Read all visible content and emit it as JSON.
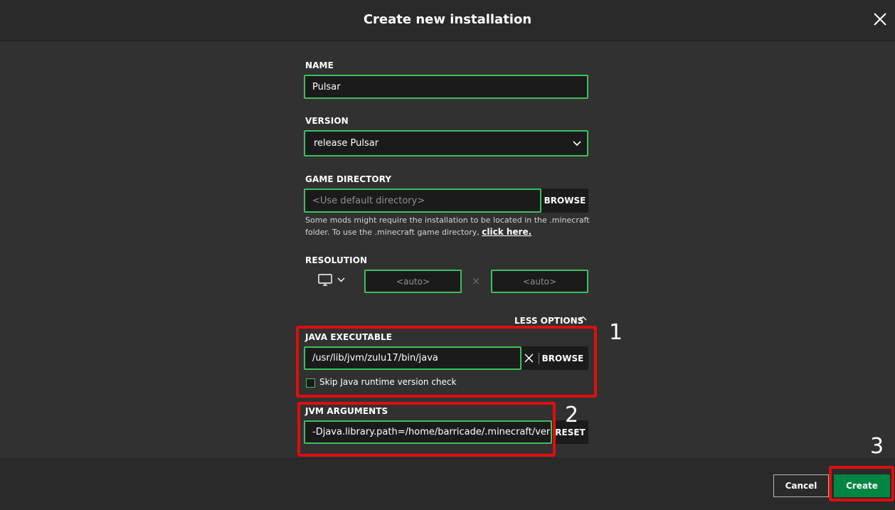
{
  "dialog": {
    "title": "Create new installation"
  },
  "icons": {
    "close": "close-icon",
    "dropdown": "chevron-down-icon",
    "monitor": "monitor-icon",
    "clear": "close-icon",
    "less": "chevron-up-icon"
  },
  "name": {
    "label": "NAME",
    "value": "Pulsar"
  },
  "version": {
    "label": "VERSION",
    "value": "release Pulsar"
  },
  "game_directory": {
    "label": "GAME DIRECTORY",
    "placeholder": "<Use default directory>",
    "browse_label": "BROWSE",
    "note": "Some mods might require the installation to be located in the .minecraft folder. To use the .minecraft game directory,",
    "note_link": "click here."
  },
  "resolution": {
    "label": "RESOLUTION",
    "width_placeholder": "<auto>",
    "height_placeholder": "<auto>",
    "separator": "×"
  },
  "options_toggle": "LESS OPTIONS",
  "java": {
    "label": "JAVA EXECUTABLE",
    "value": "/usr/lib/jvm/zulu17/bin/java",
    "browse_label": "BROWSE",
    "skip_check_label": "Skip Java runtime version check",
    "skip_check_checked": false
  },
  "jvm": {
    "label": "JVM ARGUMENTS",
    "value": "-Djava.library.path=/home/barricade/.minecraft/versions/I",
    "reset_label": "RESET"
  },
  "annotations": [
    "1",
    "2",
    "3"
  ],
  "footer": {
    "cancel_label": "Cancel",
    "create_label": "Create"
  },
  "colors": {
    "background": "#313131",
    "field_background": "#1b1b1b",
    "field_border": "#3dbf5d",
    "primary_button": "#008542",
    "annotation": "#e00d0d"
  }
}
